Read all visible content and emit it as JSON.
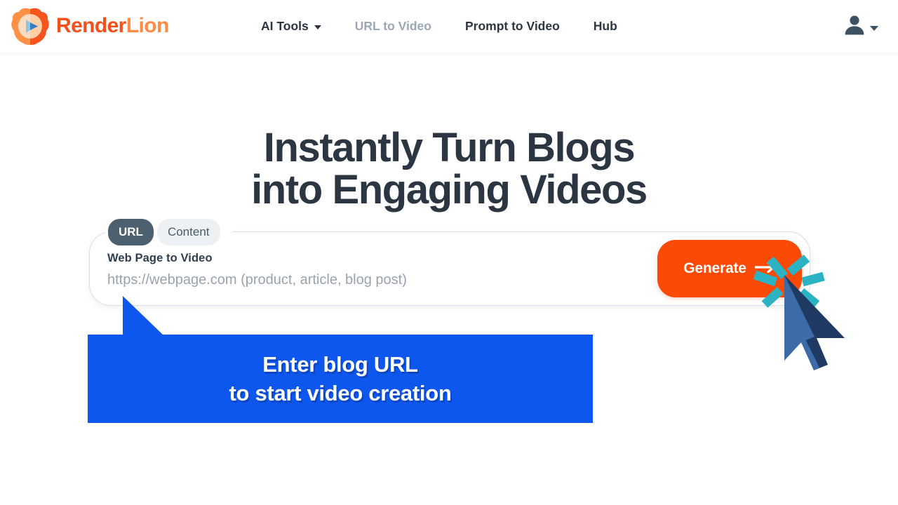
{
  "brand": {
    "logo_icon": "lion-play-logo",
    "name_part1": "Render",
    "name_part2": "Lion",
    "color_primary": "#F5501C",
    "color_secondary": "#FF8B45"
  },
  "nav": {
    "items": [
      {
        "label": "AI Tools",
        "has_dropdown": true,
        "state": "default"
      },
      {
        "label": "URL to Video",
        "has_dropdown": false,
        "state": "muted"
      },
      {
        "label": "Prompt to Video",
        "has_dropdown": false,
        "state": "default"
      },
      {
        "label": "Hub",
        "has_dropdown": false,
        "state": "default"
      }
    ]
  },
  "account": {
    "icon": "user-avatar-icon",
    "dropdown_icon": "chevron-down-icon"
  },
  "hero": {
    "headline_line1": "Instantly Turn Blogs",
    "headline_line2": "into Engaging Videos",
    "headline_color": "#2B3642"
  },
  "input_card": {
    "tabs": [
      {
        "label": "URL",
        "active": true
      },
      {
        "label": "Content",
        "active": false
      }
    ],
    "field_label": "Web Page to Video",
    "field_value": "",
    "field_placeholder": "https://webpage.com (product, article, blog post)",
    "generate_label": "Generate",
    "generate_icon": "arrow-right-icon",
    "generate_color": "#FB4A05"
  },
  "annotation": {
    "callout_line1": "Enter blog URL",
    "callout_line2": "to start video creation",
    "callout_color": "#0D56EE",
    "cursor_icon": "mouse-pointer-icon",
    "click_burst_icon": "click-burst-icon",
    "burst_color": "#2BB3C4"
  }
}
